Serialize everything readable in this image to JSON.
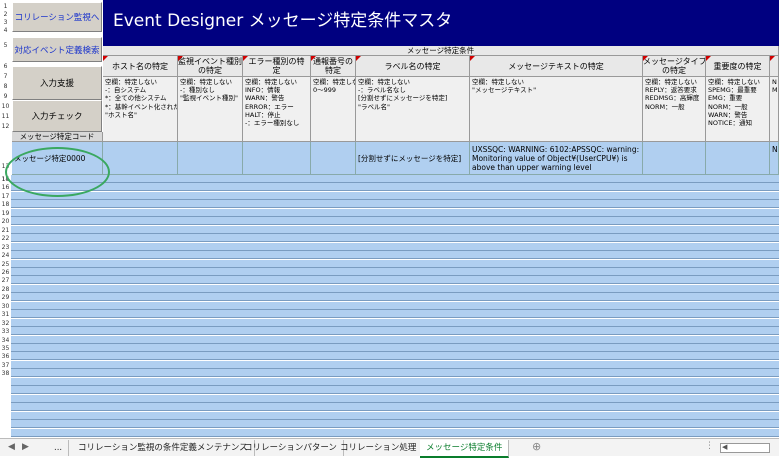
{
  "title": "Event Designer メッセージ特定条件マスタ",
  "buttons": {
    "correlation": "コリレーション監視へ",
    "event_def": "対応イベント定義検索",
    "input_support": "入力支援",
    "input_check": "入力チェック"
  },
  "section_label": "メッセージ特定コード",
  "group_header": "メッセージ特定条件",
  "columns": [
    {
      "label": "ホスト名の特定",
      "desc": "空欄：特定しない\n-：自システム\n*：全ての他システム\n*：基幹イベント化されたシステム\n\"ホスト名\""
    },
    {
      "label": "監視イベント種別\nの特定",
      "desc": "空欄：特定しない\n-：種別なし\n\"監視イベント種別\""
    },
    {
      "label": "エラー種別の特\n定",
      "desc": "空欄：特定しない\nINFO：情報\nWARN：警告\nERROR：エラー\nHALT：停止\n-：エラー種別なし"
    },
    {
      "label": "通報番号の\n特定",
      "desc": "空欄：特定しない\n0～999"
    },
    {
      "label": "ラベル名の特定",
      "desc": "空欄：特定しない\n-：ラベル名なし\n[分割せずにメッセージを特定]\n\"ラベル名\""
    },
    {
      "label": "メッセージテキストの特定",
      "desc": "空欄：特定しない\n\"メッセージテキスト\""
    },
    {
      "label": "メッセージタイプ\nの特定",
      "desc": "空欄：特定しない\nREPLY：返答要求\nREDMSG：高輝度\nNORM：一般"
    },
    {
      "label": "重要度の特定",
      "desc": "空欄：特定しない\nSPEMG：最重要\nEMG：重要\nNORM：一般\nWARN：警告\nNOTICE：通知"
    },
    {
      "label": "",
      "desc": "N\nM"
    }
  ],
  "data_row": {
    "code": "メッセージ特定0000",
    "label_name": "[分割せずにメッセージを特定]",
    "message_text": "UXSSQC: WARNING: 6102:APSSQC: warning:\nMonitoring value of Object¥(UserCPU¥) is\nabove than upper warning level",
    "last": "N"
  },
  "row_numbers": [
    "1",
    "2",
    "3",
    "4",
    "5",
    "6",
    "7",
    "8",
    "9",
    "10",
    "11",
    "12",
    "13",
    "14",
    "15",
    "16",
    "17",
    "18",
    "19",
    "20",
    "21",
    "22",
    "23",
    "24",
    "25",
    "26",
    "27",
    "28",
    "29",
    "30",
    "31",
    "32",
    "33",
    "34",
    "35",
    "36",
    "37",
    "38"
  ],
  "tabs": [
    {
      "label": "...",
      "active": false
    },
    {
      "label": "コリレーション監視の条件定義メンテナンス",
      "active": false
    },
    {
      "label": "コリレーションパターン",
      "active": false
    },
    {
      "label": "コリレーション処理",
      "active": false
    },
    {
      "label": "メッセージ特定条件",
      "active": true
    }
  ],
  "colors": {
    "title_bg": "#000080",
    "grid_blue": "#b0cff0",
    "active_tab": "#0a7d2c"
  }
}
